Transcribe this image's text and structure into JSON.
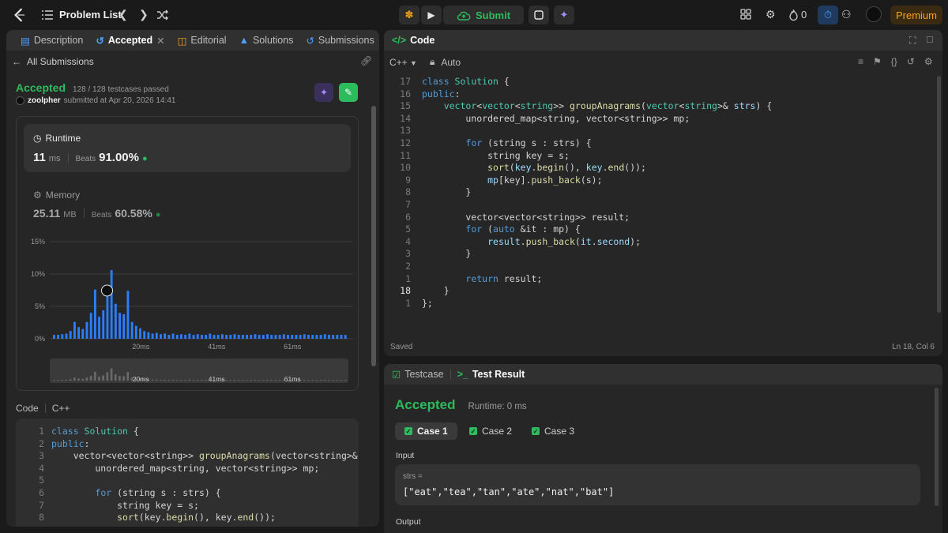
{
  "topbar": {
    "problem_list": "Problem List",
    "submit": "Submit",
    "streak": "0",
    "premium": "Premium"
  },
  "left_panel": {
    "tabs": [
      {
        "label": "Description"
      },
      {
        "label": "Accepted"
      },
      {
        "label": "Editorial"
      },
      {
        "label": "Solutions"
      },
      {
        "label": "Submissions"
      }
    ],
    "all_submissions": "All Submissions",
    "status": "Accepted",
    "testcases": "128 / 128 testcases passed",
    "user": "zoolpher",
    "submitted_at": "submitted at Apr 20, 2026 14:41",
    "runtime": {
      "title": "Runtime",
      "value": "11",
      "unit": "ms",
      "beats_label": "Beats",
      "beats": "91.00%"
    },
    "memory": {
      "title": "Memory",
      "value": "25.11",
      "unit": "MB",
      "beats_label": "Beats",
      "beats": "60.58%"
    },
    "code_label": "Code",
    "lang_label": "C++"
  },
  "chart_data": {
    "type": "bar",
    "y_ticks": [
      "15%",
      "10%",
      "5%",
      "0%"
    ],
    "x_ticks": [
      "20ms",
      "41ms",
      "61ms"
    ],
    "ylim": [
      0,
      15
    ],
    "values": [
      0.6,
      0.6,
      0.7,
      0.8,
      1.2,
      2.6,
      1.8,
      1.5,
      2.6,
      4.0,
      7.6,
      3.4,
      4.4,
      7.2,
      10.6,
      5.4,
      4.0,
      3.8,
      7.4,
      2.6,
      2.0,
      1.6,
      1.2,
      1.0,
      0.8,
      0.9,
      0.7,
      0.8,
      0.6,
      0.8,
      0.6,
      0.7,
      0.6,
      0.8,
      0.6,
      0.7,
      0.6,
      0.6,
      0.8,
      0.6,
      0.6,
      0.7,
      0.6,
      0.6,
      0.7,
      0.6,
      0.6,
      0.6,
      0.6,
      0.7,
      0.6,
      0.6,
      0.7,
      0.6,
      0.6,
      0.6,
      0.7,
      0.6,
      0.6,
      0.6,
      0.6,
      0.7,
      0.6,
      0.6,
      0.6,
      0.6,
      0.7,
      0.6,
      0.6,
      0.6,
      0.6,
      0.6
    ]
  },
  "left_code": [
    [
      {
        "t": "class ",
        "c": "kw"
      },
      {
        "t": "Solution",
        "c": "tp"
      },
      {
        "t": " {",
        "c": "tx"
      }
    ],
    [
      {
        "t": "public",
        "c": "kw"
      },
      {
        "t": ":",
        "c": "tx"
      }
    ],
    [
      {
        "t": "    vector<vector<string>> ",
        "c": "tx"
      },
      {
        "t": "groupAnagrams",
        "c": "fn"
      },
      {
        "t": "(vector<string>& strs)",
        "c": "tx"
      }
    ],
    [
      {
        "t": "        unordered_map<string, vector<string>> mp;",
        "c": "tx"
      }
    ],
    [],
    [
      {
        "t": "        ",
        "c": "tx"
      },
      {
        "t": "for",
        "c": "kw"
      },
      {
        "t": " (string s : strs) {",
        "c": "tx"
      }
    ],
    [
      {
        "t": "            string key = s;",
        "c": "tx"
      }
    ],
    [
      {
        "t": "            ",
        "c": "tx"
      },
      {
        "t": "sort",
        "c": "fn"
      },
      {
        "t": "(key.",
        "c": "tx"
      },
      {
        "t": "begin",
        "c": "fn"
      },
      {
        "t": "(), key.",
        "c": "tx"
      },
      {
        "t": "end",
        "c": "fn"
      },
      {
        "t": "());",
        "c": "tx"
      }
    ]
  ],
  "code_panel": {
    "title": "Code",
    "lang": "C++",
    "mode": "Auto",
    "saved": "Saved",
    "cursor": "Ln 18, Col 6",
    "line_numbers": [
      "17",
      "16",
      "15",
      "14",
      "13",
      "12",
      "11",
      "10",
      "9",
      "8",
      "7",
      "6",
      "5",
      "4",
      "3",
      "2",
      "1",
      "18",
      "1"
    ],
    "lines": [
      [
        {
          "t": "class ",
          "c": "kw"
        },
        {
          "t": "Solution",
          "c": "tp"
        },
        {
          "t": " {",
          "c": "tx"
        }
      ],
      [
        {
          "t": "public",
          "c": "kw"
        },
        {
          "t": ":",
          "c": "tx"
        }
      ],
      [
        {
          "t": "    ",
          "c": "tx"
        },
        {
          "t": "vector",
          "c": "tp"
        },
        {
          "t": "<",
          "c": "tx"
        },
        {
          "t": "vector",
          "c": "tp"
        },
        {
          "t": "<",
          "c": "tx"
        },
        {
          "t": "string",
          "c": "tp"
        },
        {
          "t": ">> ",
          "c": "tx"
        },
        {
          "t": "groupAnagrams",
          "c": "fn"
        },
        {
          "t": "(",
          "c": "tx"
        },
        {
          "t": "vector",
          "c": "tp"
        },
        {
          "t": "<",
          "c": "tx"
        },
        {
          "t": "string",
          "c": "tp"
        },
        {
          "t": ">& ",
          "c": "tx"
        },
        {
          "t": "strs",
          "c": "vr"
        },
        {
          "t": ") {",
          "c": "tx"
        }
      ],
      [
        {
          "t": "        unordered_map<string, vector<string>> mp;",
          "c": "tx"
        }
      ],
      [],
      [
        {
          "t": "        ",
          "c": "tx"
        },
        {
          "t": "for",
          "c": "kw"
        },
        {
          "t": " (string s : strs) {",
          "c": "tx"
        }
      ],
      [
        {
          "t": "            string key = s;",
          "c": "tx"
        }
      ],
      [
        {
          "t": "            ",
          "c": "tx"
        },
        {
          "t": "sort",
          "c": "fn"
        },
        {
          "t": "(",
          "c": "tx"
        },
        {
          "t": "key",
          "c": "vr"
        },
        {
          "t": ".",
          "c": "tx"
        },
        {
          "t": "begin",
          "c": "fn"
        },
        {
          "t": "(), ",
          "c": "tx"
        },
        {
          "t": "key",
          "c": "vr"
        },
        {
          "t": ".",
          "c": "tx"
        },
        {
          "t": "end",
          "c": "fn"
        },
        {
          "t": "());",
          "c": "tx"
        }
      ],
      [
        {
          "t": "            ",
          "c": "tx"
        },
        {
          "t": "mp",
          "c": "vr"
        },
        {
          "t": "[key].",
          "c": "tx"
        },
        {
          "t": "push_back",
          "c": "fn"
        },
        {
          "t": "(s);",
          "c": "tx"
        }
      ],
      [
        {
          "t": "        }",
          "c": "tx"
        }
      ],
      [],
      [
        {
          "t": "        vector<vector<string>> result;",
          "c": "tx"
        }
      ],
      [
        {
          "t": "        ",
          "c": "tx"
        },
        {
          "t": "for",
          "c": "kw"
        },
        {
          "t": " (",
          "c": "tx"
        },
        {
          "t": "auto",
          "c": "kw"
        },
        {
          "t": " &it : mp) {",
          "c": "tx"
        }
      ],
      [
        {
          "t": "            ",
          "c": "tx"
        },
        {
          "t": "result",
          "c": "vr"
        },
        {
          "t": ".",
          "c": "tx"
        },
        {
          "t": "push_back",
          "c": "fn"
        },
        {
          "t": "(",
          "c": "tx"
        },
        {
          "t": "it",
          "c": "vr"
        },
        {
          "t": ".",
          "c": "tx"
        },
        {
          "t": "second",
          "c": "vr"
        },
        {
          "t": ");",
          "c": "tx"
        }
      ],
      [
        {
          "t": "        }",
          "c": "tx"
        }
      ],
      [],
      [
        {
          "t": "        ",
          "c": "tx"
        },
        {
          "t": "return",
          "c": "kw"
        },
        {
          "t": " result;",
          "c": "tx"
        }
      ],
      [
        {
          "t": "    }",
          "c": "tx"
        }
      ],
      [
        {
          "t": "};",
          "c": "tx"
        }
      ]
    ]
  },
  "result_panel": {
    "tab_testcase": "Testcase",
    "tab_result": "Test Result",
    "status": "Accepted",
    "runtime": "Runtime: 0 ms",
    "cases": [
      "Case 1",
      "Case 2",
      "Case 3"
    ],
    "input_label": "Input",
    "var_name": "strs =",
    "var_value": "[\"eat\",\"tea\",\"tan\",\"ate\",\"nat\",\"bat\"]",
    "output_label": "Output"
  },
  "colors": {
    "accent_green": "#2cbb5d",
    "bar_blue": "#2b7fff",
    "premium": "#ffa116"
  }
}
